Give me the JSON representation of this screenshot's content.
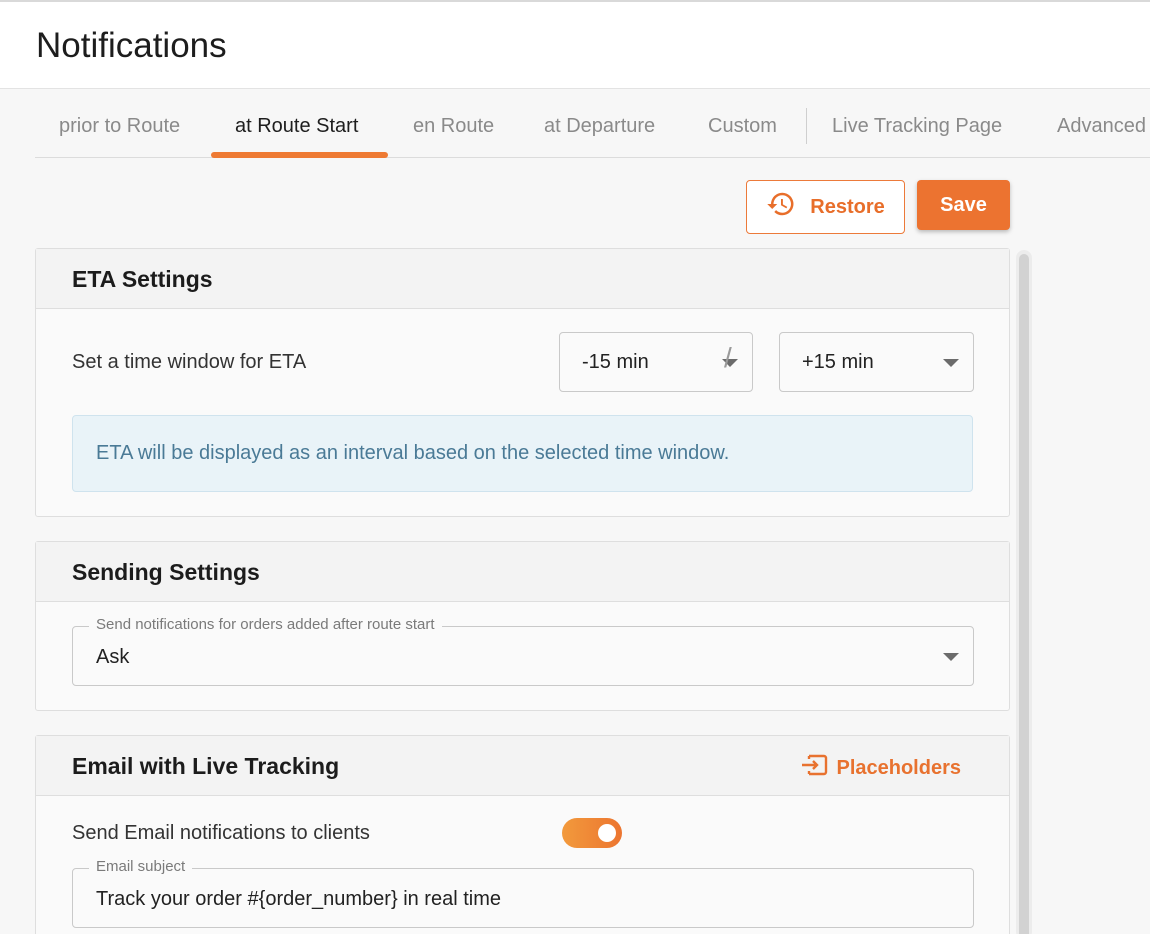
{
  "page": {
    "title": "Notifications"
  },
  "tabs": [
    {
      "label": "prior to Route"
    },
    {
      "label": "at Route Start"
    },
    {
      "label": "en Route"
    },
    {
      "label": "at Departure"
    },
    {
      "label": "Custom"
    },
    {
      "label": "Live Tracking Page"
    },
    {
      "label": "Advanced"
    }
  ],
  "active_tab": "at Route Start",
  "actions": {
    "restore_label": "Restore",
    "save_label": "Save"
  },
  "eta": {
    "title": "ETA Settings",
    "window_label": "Set a time window for ETA",
    "from_value": "-15 min",
    "to_value": "+15 min",
    "separator": "/",
    "info": "ETA will be displayed as an interval based on the selected time window."
  },
  "sending": {
    "title": "Sending Settings",
    "select_label": "Send notifications for orders added after route start",
    "select_value": "Ask"
  },
  "email": {
    "title": "Email with Live Tracking",
    "placeholders_label": "Placeholders",
    "toggle_label": "Send Email notifications to clients",
    "toggle_on": true,
    "subject_label": "Email subject",
    "subject_value": "Track your order #{order_number} in real time"
  },
  "colors": {
    "accent": "#ec7330",
    "info_bg": "#e9f3f8",
    "info_text": "#4a7a96"
  },
  "icons": {
    "restore": "history-icon",
    "placeholders": "insert-icon",
    "caret": "caret-down-icon"
  }
}
